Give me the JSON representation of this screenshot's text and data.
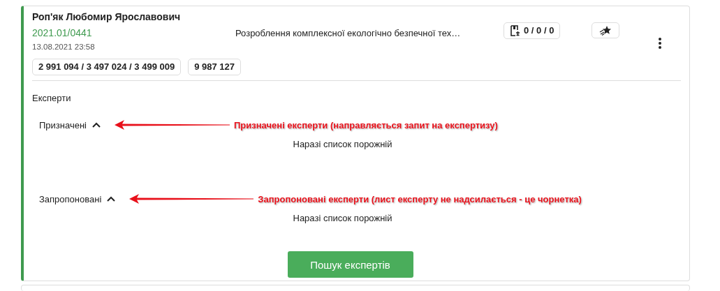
{
  "card": {
    "name": "Роп'як Любомир Ярославович",
    "code": "2021.01/0441",
    "date": "13.08.2021 23:58",
    "title": "Розроблення комплексної екологічно безпечної тех…",
    "counter": "0 / 0 / 0",
    "amounts": [
      "2 991 094 / 3 497 024 / 3 499 009",
      "9 987 127"
    ],
    "section_title": "Експерти",
    "groups": [
      {
        "label": "Призначені",
        "expanded": true,
        "empty_text": "Наразі список порожній",
        "annotation": "Призначені експерти (направляється запит на експертизу)"
      },
      {
        "label": "Запропоновані",
        "expanded": true,
        "empty_text": "Наразі список порожній",
        "annotation": "Запропоновані експерти (лист експерту не надсилається - це чорнетка)"
      }
    ],
    "button": "Пошук експертів"
  }
}
